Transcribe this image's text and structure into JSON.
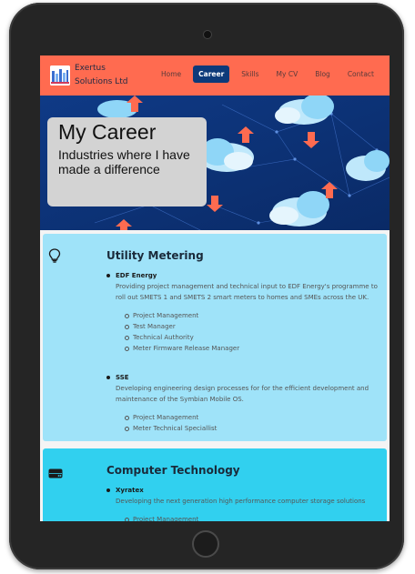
{
  "header": {
    "brand": "Exertus Solutions Ltd",
    "nav": [
      "Home",
      "Career",
      "Skills",
      "My CV",
      "Blog",
      "Contact"
    ],
    "active": "Career"
  },
  "hero": {
    "title": "My Career",
    "subtitle": "Industries where I have made a difference"
  },
  "sections": [
    {
      "title": "Utility Metering",
      "icon": "lightbulb-icon",
      "employers": [
        {
          "name": "EDF Energy",
          "description": "Providing project management and technical input to EDF Energy's programme to roll out SMETS 1 and SMETS 2 smart meters to homes and SMEs across the UK.",
          "roles": [
            "Project Management",
            "Test Manager",
            "Technical Authority",
            "Meter Firmware Release Manager"
          ]
        },
        {
          "name": "SSE",
          "description": "Developing engineering design processes for for the efficient development and maintenance of the Symbian Mobile OS.",
          "roles": [
            "Project Management",
            "Meter Technical Speciallist"
          ]
        }
      ]
    },
    {
      "title": "Computer Technology",
      "icon": "hard-drive-icon",
      "employers": [
        {
          "name": "Xyratex",
          "description": "Developing the next generation high performance computer storage solutions",
          "roles": [
            "Project Management"
          ]
        }
      ]
    }
  ],
  "colors": {
    "header_bg": "#ff6b50",
    "nav_active_bg": "#0d3a7a",
    "hero_bg": "#113b86",
    "section1_bg": "#9fe3f9",
    "section2_bg": "#31d0ef"
  }
}
